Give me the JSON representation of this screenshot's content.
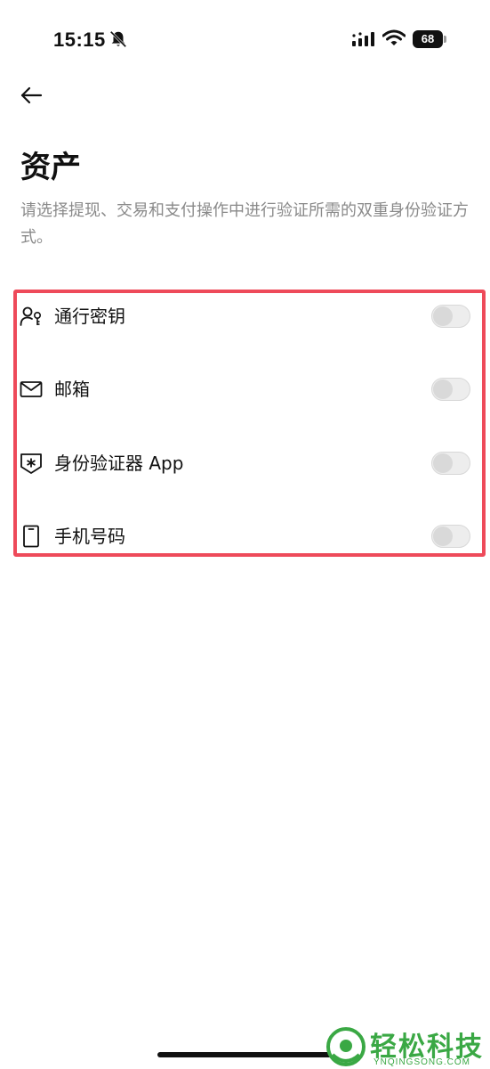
{
  "status_bar": {
    "time": "15:15",
    "battery": "68"
  },
  "header": {
    "title": "资产",
    "description": "请选择提现、交易和支付操作中进行验证所需的双重身份验证方式。"
  },
  "options": [
    {
      "label": "通行密钥",
      "icon": "passkey-icon",
      "enabled": false
    },
    {
      "label": "邮箱",
      "icon": "mail-icon",
      "enabled": false
    },
    {
      "label": "身份验证器 App",
      "icon": "authenticator-shield-icon",
      "enabled": false
    },
    {
      "label": "手机号码",
      "icon": "phone-icon",
      "enabled": false
    }
  ],
  "watermark": {
    "text": "轻松科技",
    "sub": "YNQINGSONG.COM"
  },
  "colors": {
    "highlight": "#ee4a5a",
    "watermark": "#3aa844",
    "description": "#8a8a8a"
  }
}
